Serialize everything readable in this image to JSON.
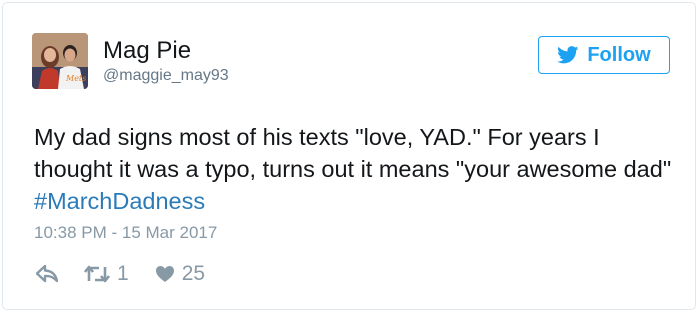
{
  "user": {
    "display_name": "Mag Pie",
    "username": "@maggie_may93"
  },
  "follow_button": {
    "label": "Follow"
  },
  "tweet": {
    "text_before": "My dad signs most of his texts \"love, YAD.\" For years I thought it was a typo, turns out it means \"your awesome dad\" ",
    "hashtag": "#MarchDadness",
    "timestamp": "10:38 PM - 15 Mar 2017"
  },
  "actions": {
    "reply_icon": "reply-icon",
    "retweet_icon": "retweet-icon",
    "retweet_count": "1",
    "like_icon": "heart-icon",
    "like_count": "25"
  },
  "colors": {
    "accent": "#1da1f2",
    "hashtag": "#2b7bb9",
    "text": "#14171a",
    "muted": "#657786",
    "meta": "#8899a6",
    "border": "#e1e8ed"
  }
}
